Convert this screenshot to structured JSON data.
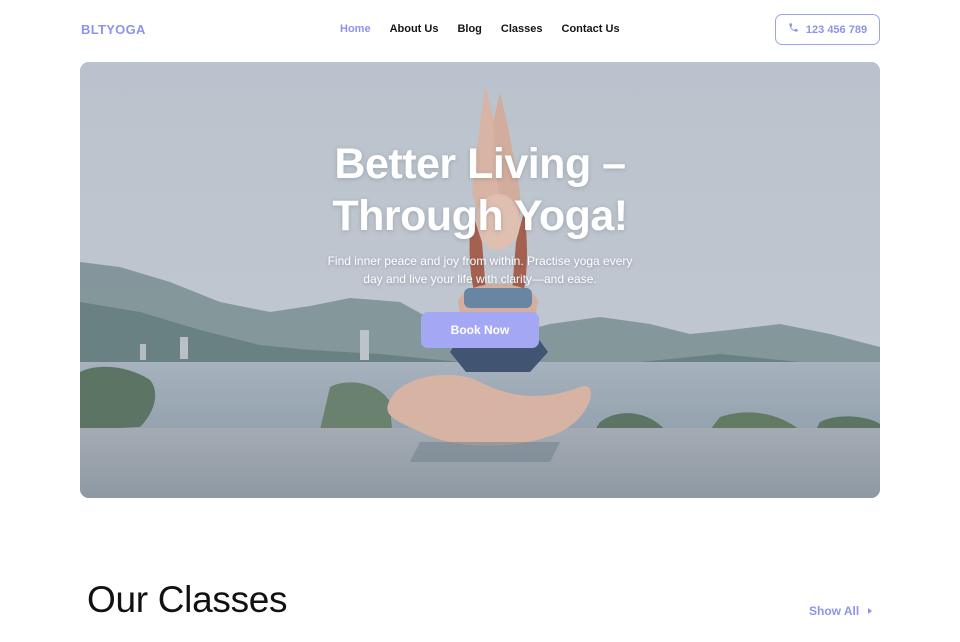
{
  "header": {
    "logo": "BLTYOGA",
    "nav": [
      {
        "label": "Home",
        "active": true
      },
      {
        "label": "About Us",
        "active": false
      },
      {
        "label": "Blog",
        "active": false
      },
      {
        "label": "Classes",
        "active": false
      },
      {
        "label": "Contact Us",
        "active": false
      }
    ],
    "phone": {
      "icon": "phone-icon",
      "label": "123 456 789"
    }
  },
  "hero": {
    "title_line1": "Better Living –",
    "title_line2": "Through Yoga!",
    "subtitle_line1": "Find inner peace and joy from within. Practise yoga every",
    "subtitle_line2": "day and live your life with clarity—and ease.",
    "cta_label": "Book Now",
    "image": "woman-doing-yoga-by-sea"
  },
  "classes": {
    "title": "Our Classes",
    "show_all_label": "Show All",
    "show_all_icon": "chevron-right-icon"
  },
  "colors": {
    "accent": "#8d93ee",
    "button": "#a4a8f4",
    "text": "#141414"
  }
}
